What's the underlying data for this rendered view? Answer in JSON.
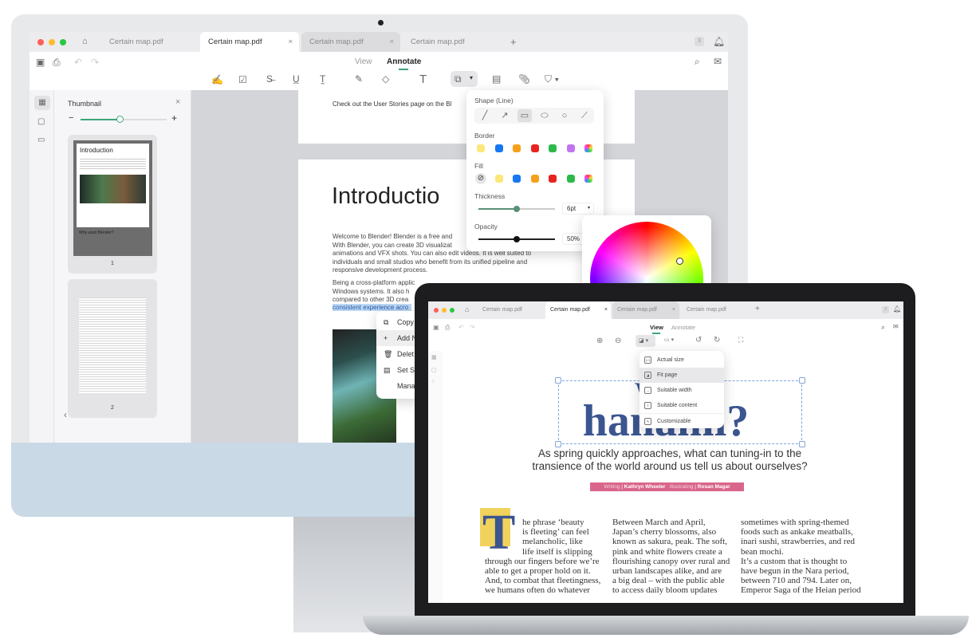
{
  "desktop": {
    "tabs": [
      "Certain map.pdf",
      "Certain map.pdf",
      "Certain map.pdf",
      "Certain map.pdf"
    ],
    "tab_close": "×",
    "new_tab": "+",
    "badge": "3",
    "modes": {
      "view": "View",
      "annotate": "Annotate",
      "active": "Annotate"
    },
    "thumbnail": {
      "title": "Thumbnail",
      "close": "×",
      "minus": "−",
      "plus": "+",
      "zoom_level": 0.45,
      "page1": {
        "title": "Introduction",
        "sub": "Why used Blender?",
        "num": "1"
      },
      "page2": {
        "num": "2"
      },
      "collapse": "‹"
    },
    "document": {
      "top_line": "Check out the User Stories page on the Bl",
      "heading": "Introductio",
      "para1": [
        "Welcome to Blender! Blender is a free and",
        "With Blender, you can create 3D visualizat",
        "animations and VFX shots. You can also edit videos. It is well suited to",
        "individuals and small studios who benefit from its unified pipeline and",
        "responsive development process."
      ],
      "para2": [
        "Being a cross-platform applic",
        "Windows systems. It also h",
        "compared to other 3D crea"
      ],
      "highlight": "consistent experience acro"
    },
    "context_menu": [
      "Copy",
      "Add N",
      "Delet",
      "Set S",
      "Mana"
    ],
    "shape_panel": {
      "title": "Shape (Line)",
      "shapes": [
        "line",
        "arrow",
        "rectangle",
        "ellipse",
        "circle",
        "connector"
      ],
      "selected_shape": "rectangle",
      "border_label": "Border",
      "border_colors": [
        "#fde77a",
        "#1677f2",
        "#f6a01a",
        "#e8231f",
        "#2db84a",
        "#c174f0",
        "multicolor"
      ],
      "fill_label": "Fill",
      "fill_colors": [
        "none",
        "#fde77a",
        "#1677f2",
        "#f6a01a",
        "#e8231f",
        "#2db84a",
        "multicolor"
      ],
      "thickness_label": "Thickness",
      "thickness_value": "6pt",
      "thickness_level": 0.5,
      "opacity_label": "Opacity",
      "opacity_value": "50%",
      "opacity_level": 0.5
    },
    "accent": "#3aa57a"
  },
  "laptop": {
    "tabs": [
      "Certain map.pdf",
      "Certain map.pdf",
      "Certain map.pdf",
      "Certain map.pdf"
    ],
    "tab_close": "×",
    "new_tab": "+",
    "badge": "3",
    "modes": {
      "view": "View",
      "annotate": "Annotate",
      "active": "View"
    },
    "fit_menu": [
      "Actual size",
      "Fit page",
      "Suitable width",
      "Suitable content",
      "Customizable"
    ],
    "fit_selected": "Fit page",
    "article": {
      "title_line1": "Why",
      "title_line2": "hanami?",
      "subtitle": [
        "As spring quickly approaches, what can tuning-in to the",
        "transience of the world around us tell us about ourselves?"
      ],
      "byline": {
        "writing_label": "Writing",
        "writer": "Kathryn Wheeler",
        "illustrating_label": "Illustrating",
        "illustrator": "Rosan Magar"
      },
      "dropcap": "T",
      "col1": [
        "he phrase ‘beauty",
        "is fleeting’ can feel",
        "melancholic, like",
        "life itself is slipping",
        "through our fingers before we’re",
        "able to get a proper hold on it.",
        "And, to combat that fleetingness,",
        "we humans often do whatever"
      ],
      "col2": [
        "  Between March and April,",
        "Japan’s cherry blossoms, also",
        "known as sakura, peak. The soft,",
        "pink and white flowers create a",
        "flourishing canopy over rural and",
        "urban landscapes alike, and are",
        "a big deal – with the public able",
        "to access daily bloom updates"
      ],
      "col3": [
        "sometimes with spring-themed",
        "foods such as ankake meatballs,",
        "inari sushi, strawberries, and red",
        "bean mochi.",
        "  It’s a custom that is thought to",
        "have begun in the Nara period,",
        "between 710 and 794. Later on,",
        "Emperor Saga of the Heian period"
      ]
    },
    "colors": {
      "heading": "#3b5590",
      "byline": "#d9668a",
      "dropcap_bg": "#f1d25c"
    }
  }
}
